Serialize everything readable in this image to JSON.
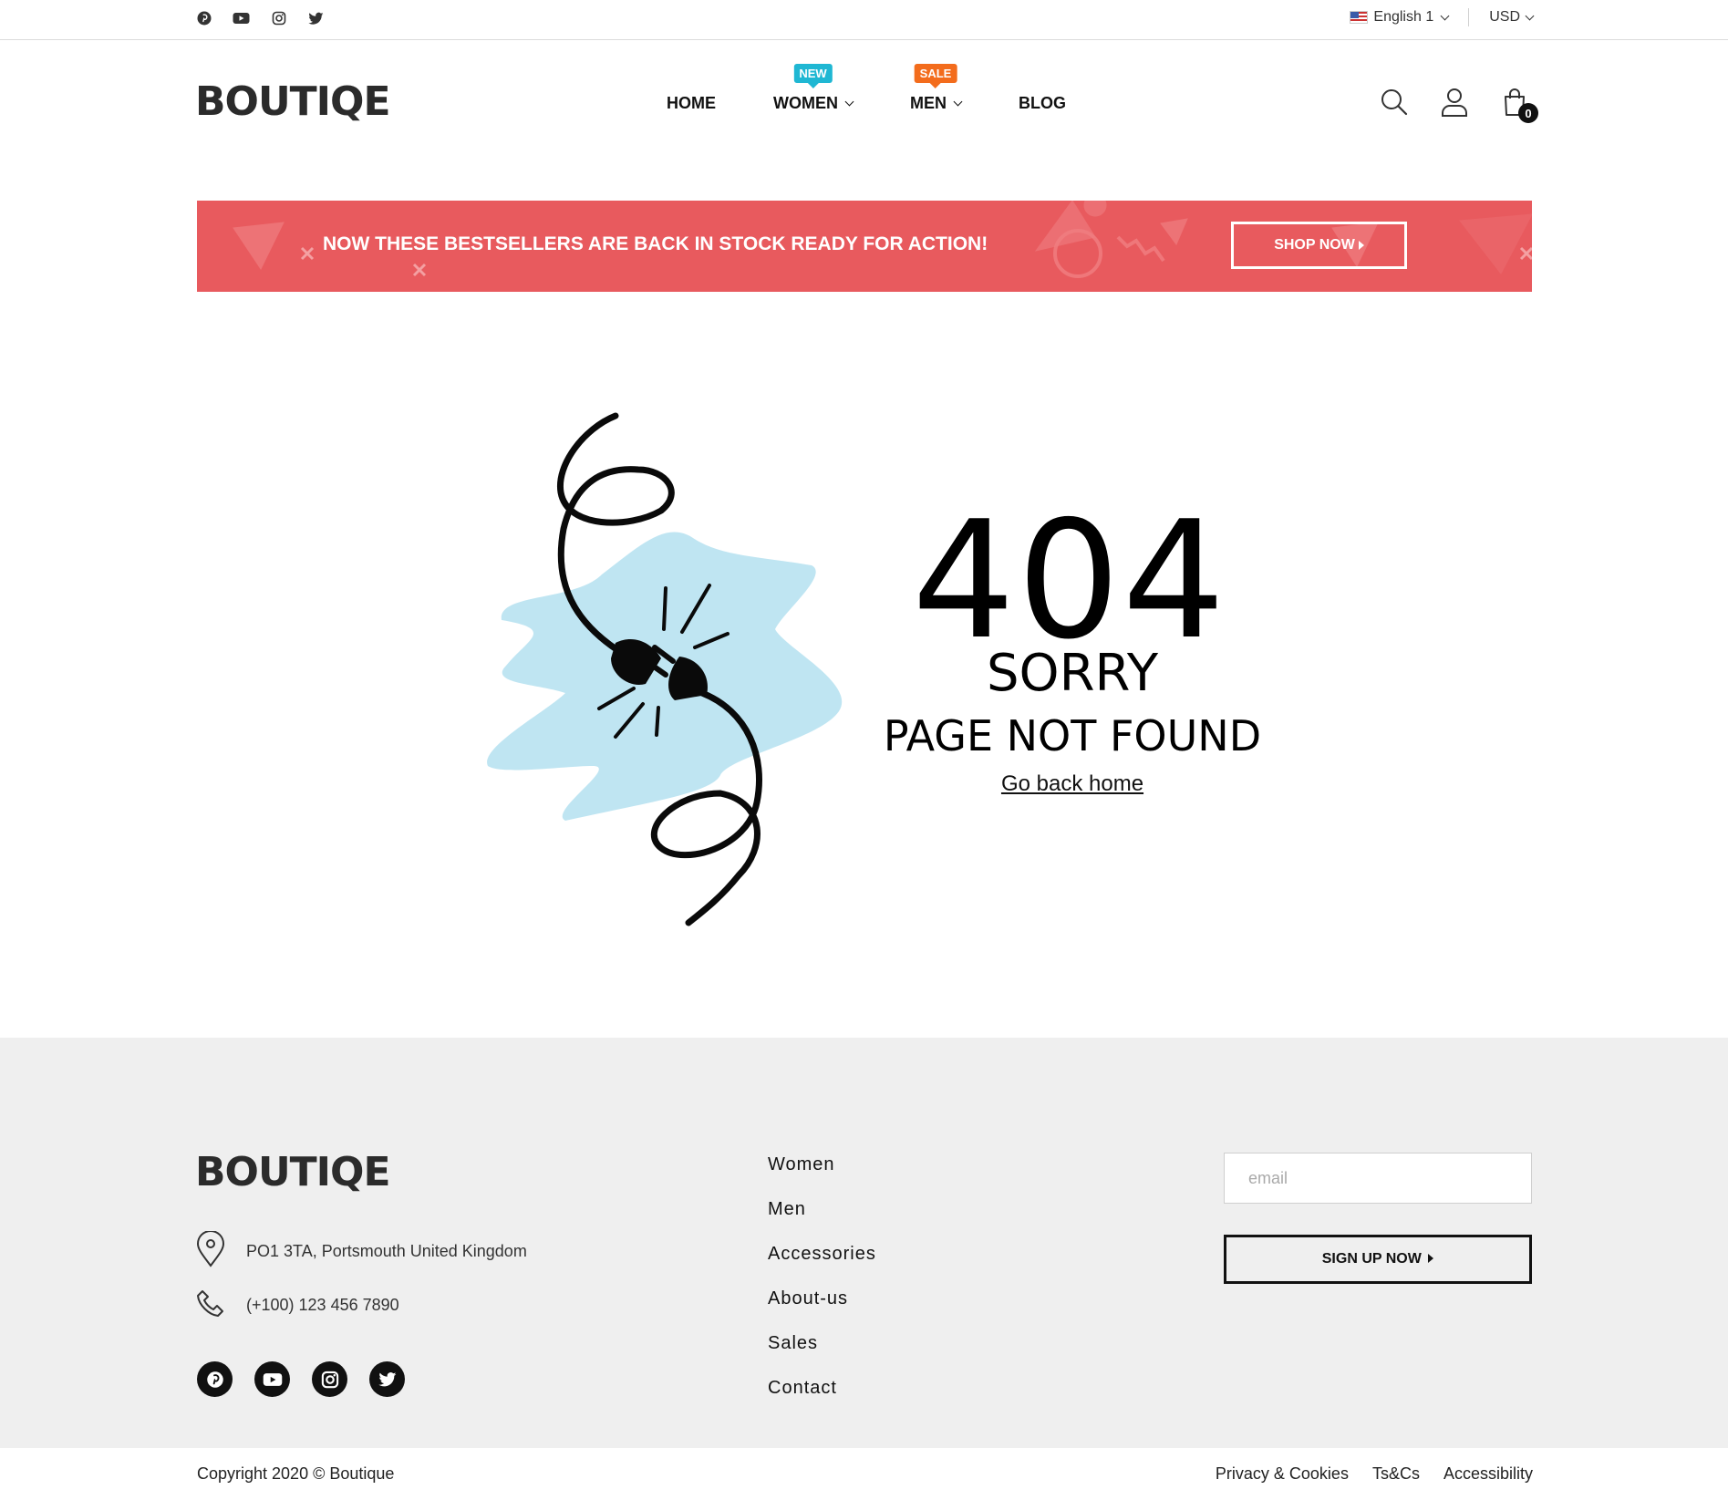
{
  "topbar": {
    "social_icons": [
      "pinterest-icon",
      "youtube-icon",
      "instagram-icon",
      "twitter-icon"
    ],
    "language": "English 1",
    "currency": "USD"
  },
  "header": {
    "logo": "BOUTIQE",
    "nav": {
      "home": "HOME",
      "women": "WOMEN",
      "women_badge": "NEW",
      "men": "MEN",
      "men_badge": "SALE",
      "blog": "BLOG"
    },
    "cart_count": "0"
  },
  "banner": {
    "text": "NOW THESE BESTSELLERS ARE BACK IN STOCK READY FOR ACTION!",
    "button": "SHOP NOW"
  },
  "error": {
    "code": "404",
    "sorry": "SORRY",
    "message": "PAGE NOT FOUND",
    "link": "Go back home"
  },
  "footer": {
    "logo": "BOUTIQE",
    "address": "PO1 3TA, Portsmouth United Kingdom",
    "phone": "(+100) 123 456 7890",
    "links": [
      "Women",
      "Men",
      "Accessories",
      "About-us",
      "Sales",
      "Contact"
    ],
    "email_placeholder": "email",
    "signup_button": "SIGN UP NOW"
  },
  "bottom": {
    "copyright": "Copyright 2020 © Boutique",
    "legal": [
      "Privacy & Cookies",
      "Ts&Cs",
      "Accessibility"
    ]
  },
  "colors": {
    "banner": "#e85a5e",
    "badge_new": "#1fb7d3",
    "badge_sale": "#f36c1c",
    "blob": "#bfe5f2",
    "footer_bg": "#efefef"
  }
}
